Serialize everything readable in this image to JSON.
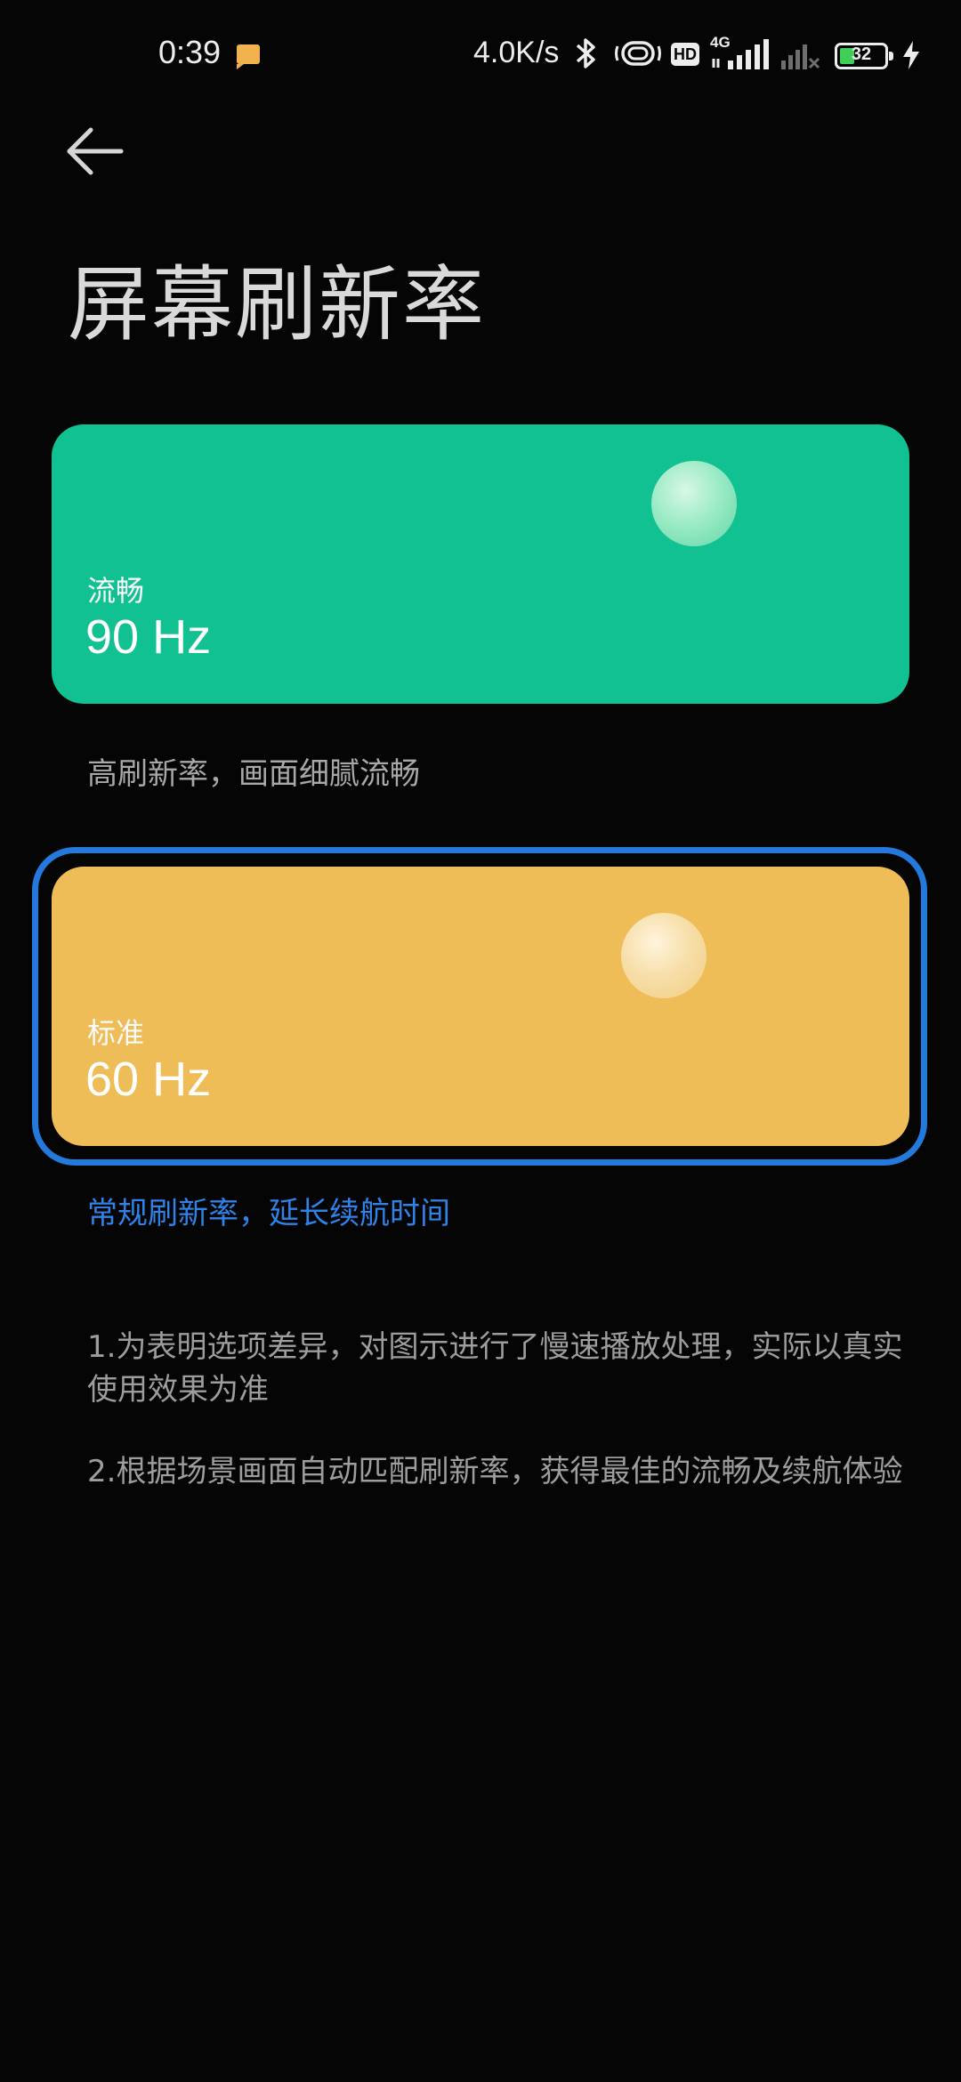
{
  "status_bar": {
    "time": "0:39",
    "net_speed": "4.0K/s",
    "network_type": "4G",
    "hd_badge": "HD",
    "battery_level": "32",
    "icons": [
      "notification-icon",
      "bluetooth-icon",
      "vibrate-icon",
      "hd-icon",
      "signal-icon",
      "signal-no-service-icon",
      "battery-icon",
      "charging-icon"
    ]
  },
  "header": {
    "title": "屏幕刷新率"
  },
  "options": [
    {
      "mode": "流畅",
      "rate": "90 Hz",
      "description": "高刷新率，画面细腻流畅",
      "color": "#11c191",
      "selected": false
    },
    {
      "mode": "标准",
      "rate": "60 Hz",
      "description": "常规刷新率，延长续航时间",
      "color": "#eebd58",
      "selected": true
    }
  ],
  "selection_color": "#2479dc",
  "notes": [
    "1.为表明选项差异，对图示进行了慢速播放处理，实际以真实使用效果为准",
    "2.根据场景画面自动匹配刷新率，获得最佳的流畅及续航体验"
  ]
}
